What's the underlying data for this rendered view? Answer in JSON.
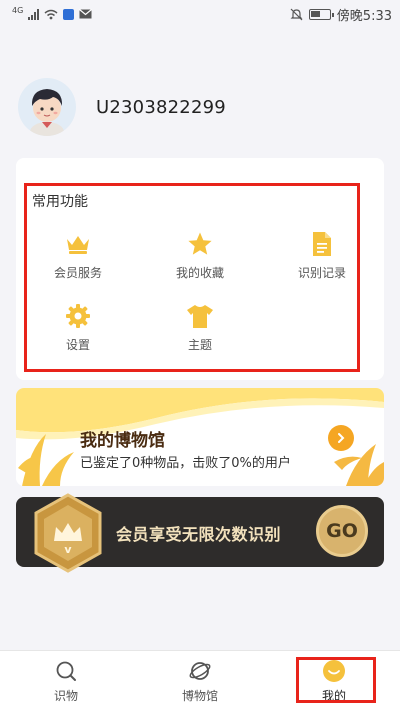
{
  "status_bar": {
    "network": "4G",
    "time": "傍晚5:33",
    "battery_level": 0.55
  },
  "profile": {
    "username": "U2303822299"
  },
  "functions": {
    "title": "常用功能",
    "items": [
      {
        "label": "会员服务",
        "icon": "crown-icon"
      },
      {
        "label": "我的收藏",
        "icon": "star-icon"
      },
      {
        "label": "识别记录",
        "icon": "document-icon"
      },
      {
        "label": "设置",
        "icon": "gear-icon"
      },
      {
        "label": "主题",
        "icon": "shirt-icon"
      }
    ]
  },
  "museum_banner": {
    "title": "我的博物馆",
    "subtitle": "已鉴定了0种物品，击败了0%的用户"
  },
  "vip_banner": {
    "text": "会员享受无限次数识别",
    "go_label": "GO"
  },
  "bottom_nav": {
    "items": [
      {
        "label": "识物",
        "icon": "search-icon",
        "active": false
      },
      {
        "label": "博物馆",
        "icon": "planet-icon",
        "active": false
      },
      {
        "label": "我的",
        "icon": "smile-icon",
        "active": true
      }
    ]
  },
  "colors": {
    "accent_yellow": "#f5c13c",
    "highlight_red": "#e8231a",
    "vip_dark": "#2e2c2b",
    "vip_gold": "#d8b36d"
  }
}
